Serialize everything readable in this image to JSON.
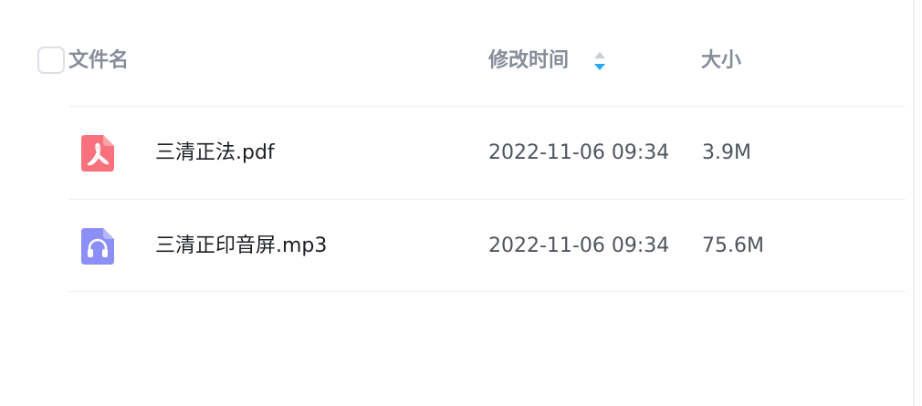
{
  "header": {
    "name_label": "文件名",
    "time_label": "修改时间",
    "size_label": "大小",
    "sort_icon": "sort-arrows-icon",
    "sort_active_color": "#2ba8f0"
  },
  "files": [
    {
      "name": "三清正法.pdf",
      "modified": "2022-11-06 09:34",
      "size": "3.9M",
      "icon": "pdf-file-icon",
      "icon_color": "#f9717d"
    },
    {
      "name": "三清正印音屏.mp3",
      "modified": "2022-11-06 09:34",
      "size": "75.6M",
      "icon": "audio-file-icon",
      "icon_color": "#8c8ff8"
    }
  ]
}
